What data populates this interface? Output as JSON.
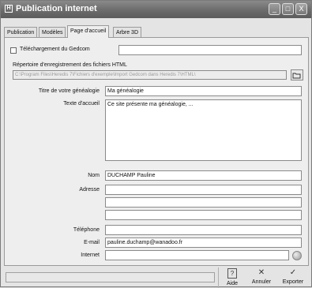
{
  "window": {
    "title": "Publication internet",
    "app_icon": "program-icon",
    "controls": {
      "minimize": "_",
      "maximize": "□",
      "close": "X"
    }
  },
  "tabs": [
    {
      "label": "Publication",
      "active": false
    },
    {
      "label": "Modèles",
      "active": false
    },
    {
      "label": "Page d'accueil",
      "active": true
    },
    {
      "label": "Arbre 3D",
      "active": false
    }
  ],
  "gedcom": {
    "checkbox_label": "Téléchargement du Gedcom",
    "checked": false,
    "value": ""
  },
  "html_dir": {
    "label": "Répertoire d'enregistrement des fichiers HTML",
    "value": "C:\\Program Files\\Heredis 7\\Fichiers d'exemple\\Import Gedcom dans Heredis 7\\HTML\\"
  },
  "form": {
    "titre_label": "Titre de votre généalogie",
    "titre_value": "Ma généalogie",
    "texte_label": "Texte d'accueil",
    "texte_value": "Ce site présente ma généalogie, ...",
    "nom_label": "Nom",
    "nom_value": "DUCHAMP Pauline",
    "adresse_label": "Adresse",
    "adresse_lines": [
      "",
      "",
      ""
    ],
    "telephone_label": "Téléphone",
    "telephone_value": "",
    "email_label": "E-mail",
    "email_value": "pauline.duchamp@wanadoo.fr",
    "internet_label": "Internet",
    "internet_value": ""
  },
  "buttons": {
    "aide": "Aide",
    "annuler": "Annuler",
    "exporter": "Exporter"
  },
  "icons": {
    "aide": "?",
    "annuler": "✕",
    "exporter": "✓"
  }
}
